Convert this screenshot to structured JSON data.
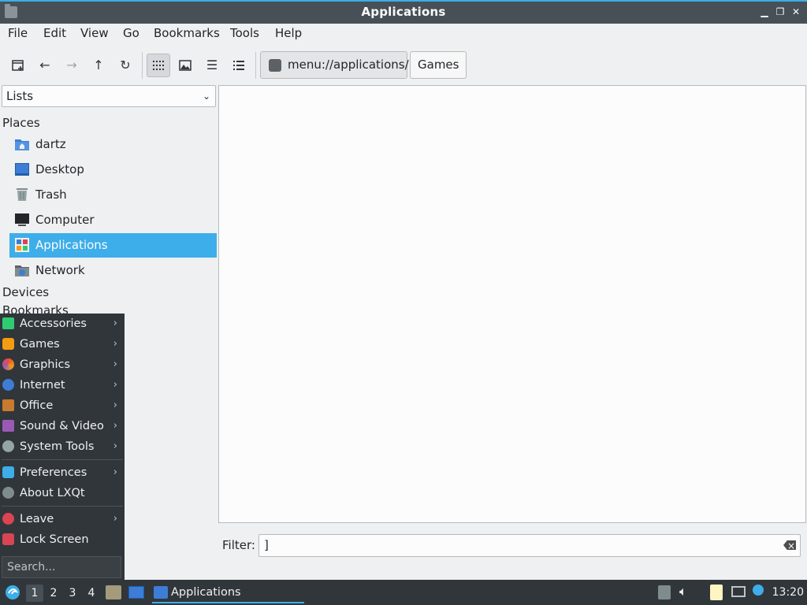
{
  "window": {
    "title": "Applications"
  },
  "menubar": [
    "File",
    "Edit",
    "View",
    "Go",
    "Bookmarks",
    "Tools",
    "Help"
  ],
  "path": {
    "root": "menu://applications/",
    "current": "Games"
  },
  "side": {
    "mode": "Lists",
    "places_header": "Places",
    "places": [
      {
        "label": "dartz",
        "icon": "home-folder-icon"
      },
      {
        "label": "Desktop",
        "icon": "desktop-icon"
      },
      {
        "label": "Trash",
        "icon": "trash-icon"
      },
      {
        "label": "Computer",
        "icon": "computer-icon"
      },
      {
        "label": "Applications",
        "icon": "applications-icon",
        "selected": true
      },
      {
        "label": "Network",
        "icon": "network-folder-icon"
      }
    ],
    "devices_header": "Devices",
    "bookmarks_header": "Bookmarks"
  },
  "filter": {
    "label": "Filter:",
    "value": "]"
  },
  "startmenu": {
    "items": [
      {
        "label": "Accessories",
        "submenu": true,
        "color": "#2ecc71"
      },
      {
        "label": "Games",
        "submenu": true,
        "color": "#f39c12"
      },
      {
        "label": "Graphics",
        "submenu": true,
        "color": "#e74c3c"
      },
      {
        "label": "Internet",
        "submenu": true,
        "color": "#3d7dd6"
      },
      {
        "label": "Office",
        "submenu": true,
        "color": "#c87a2e"
      },
      {
        "label": "Sound & Video",
        "submenu": true,
        "color": "#9b59b6"
      },
      {
        "label": "System Tools",
        "submenu": true,
        "color": "#95a5a6"
      },
      {
        "label": "Preferences",
        "submenu": true,
        "color": "#3daee9"
      },
      {
        "label": "About LXQt",
        "submenu": false,
        "color": "#7f8c8d"
      },
      {
        "label": "Leave",
        "submenu": true,
        "color": "#da4453"
      },
      {
        "label": "Lock Screen",
        "submenu": false,
        "color": "#da4453"
      }
    ],
    "search_placeholder": "Search..."
  },
  "taskbar": {
    "workspaces": [
      "1",
      "2",
      "3",
      "4"
    ],
    "task_label": "Applications",
    "clock": "13:20"
  },
  "colors": {
    "accent": "#3daee9",
    "panel": "#31363b",
    "titlebar": "#475057"
  }
}
